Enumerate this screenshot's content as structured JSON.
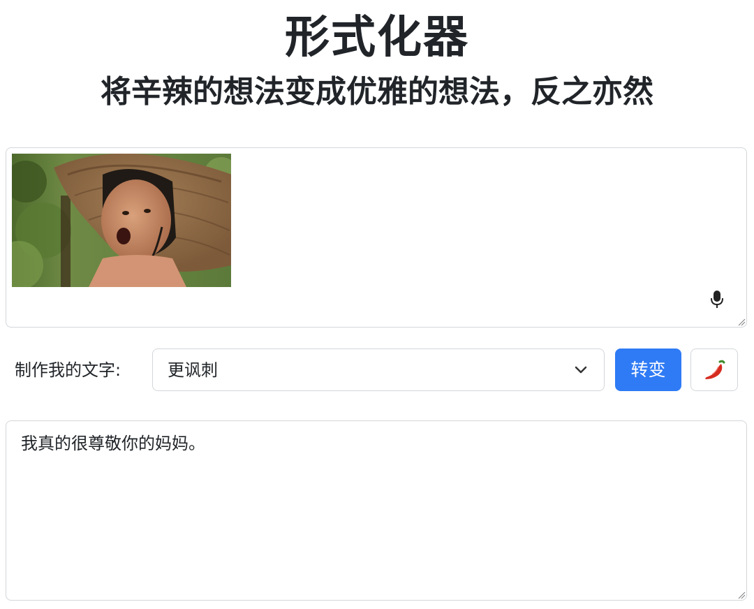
{
  "header": {
    "title": "形式化器",
    "subtitle": "将辛辣的想法变成优雅的想法，反之亦然"
  },
  "input": {
    "image_alt": "meme-photo",
    "mic_icon": "microphone-icon"
  },
  "controls": {
    "label": "制作我的文字:",
    "selected_option": "更讽刺",
    "transform_button": "转变",
    "pepper_icon": "chili-pepper-icon",
    "accent_color": "#2f7bf5"
  },
  "output": {
    "text": "我真的很尊敬你的妈妈。"
  }
}
